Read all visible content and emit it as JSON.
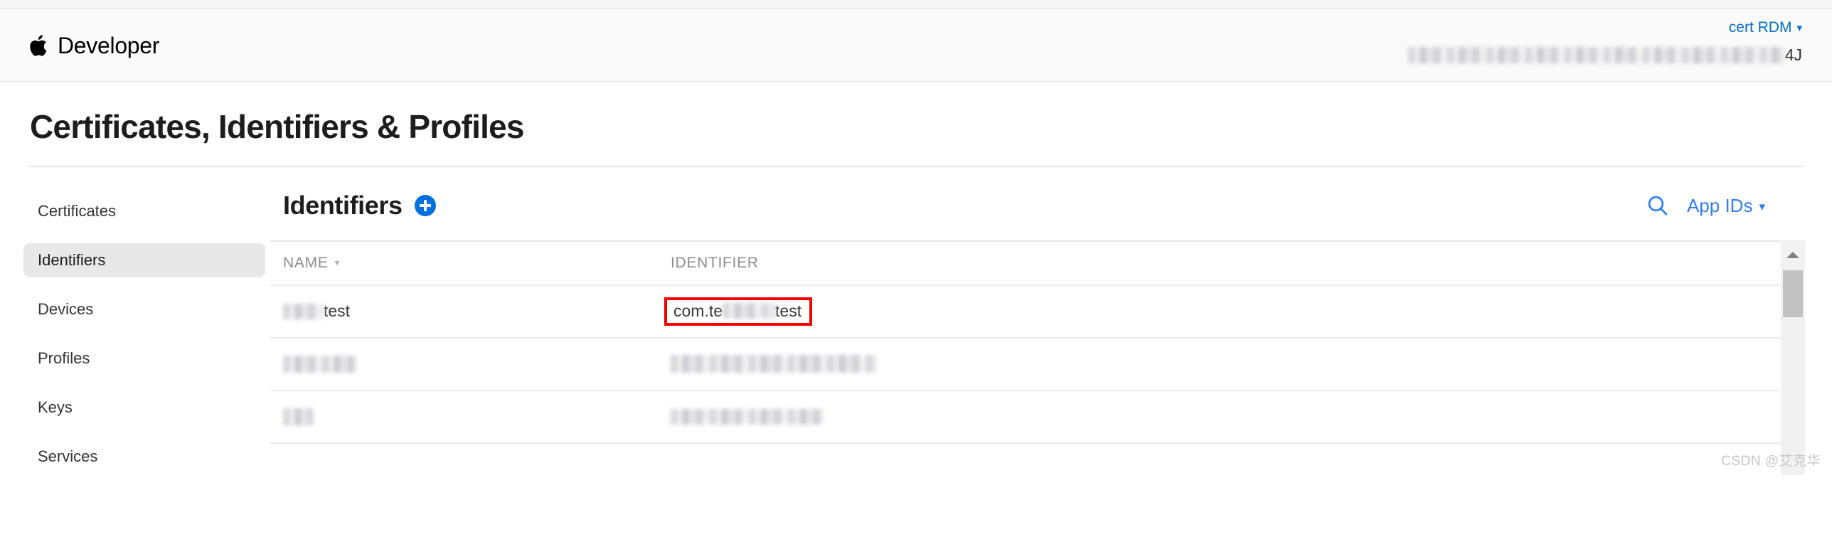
{
  "header": {
    "brand": "Developer",
    "apple_logo_icon": "apple-logo-icon",
    "team_name": "cert RDM",
    "team_chevron_icon": "chevron-down-icon",
    "team_id_suffix": "4J"
  },
  "page": {
    "title": "Certificates, Identifiers & Profiles"
  },
  "sidebar": {
    "items": [
      {
        "label": "Certificates",
        "selected": false
      },
      {
        "label": "Identifiers",
        "selected": true
      },
      {
        "label": "Devices",
        "selected": false
      },
      {
        "label": "Profiles",
        "selected": false
      },
      {
        "label": "Keys",
        "selected": false
      },
      {
        "label": "Services",
        "selected": false
      }
    ]
  },
  "main": {
    "section_title": "Identifiers",
    "add_button_label": "+",
    "add_button_icon": "plus-circle-icon",
    "search_icon": "search-icon",
    "filter_label": "App IDs",
    "filter_chevron_icon": "chevron-down-icon"
  },
  "table": {
    "columns": [
      {
        "key": "name",
        "label": "NAME",
        "sort_chevron_icon": "chevron-down-icon",
        "sortable": true
      },
      {
        "key": "identifier",
        "label": "IDENTIFIER",
        "sortable": false
      }
    ],
    "rows": [
      {
        "name_prefix_redacted": true,
        "name_suffix": "test",
        "identifier_prefix": "com.te",
        "identifier_middle_redacted": true,
        "identifier_suffix": "test",
        "identifier_highlighted": true
      },
      {
        "name_redacted": true,
        "identifier_redacted": true
      },
      {
        "name_redacted": true,
        "identifier_redacted": true
      }
    ]
  },
  "scrollbar": {
    "up_arrow_icon": "triangle-up-icon",
    "thumb": "scrollbar-thumb"
  },
  "watermark": {
    "text": "CSDN @艾克华"
  },
  "colors": {
    "link_blue": "#0070c9",
    "accent_blue": "#2d7ff0",
    "add_blue": "#0070e0",
    "highlight_red": "#f60000",
    "selected_bg": "#e8e8e8"
  }
}
